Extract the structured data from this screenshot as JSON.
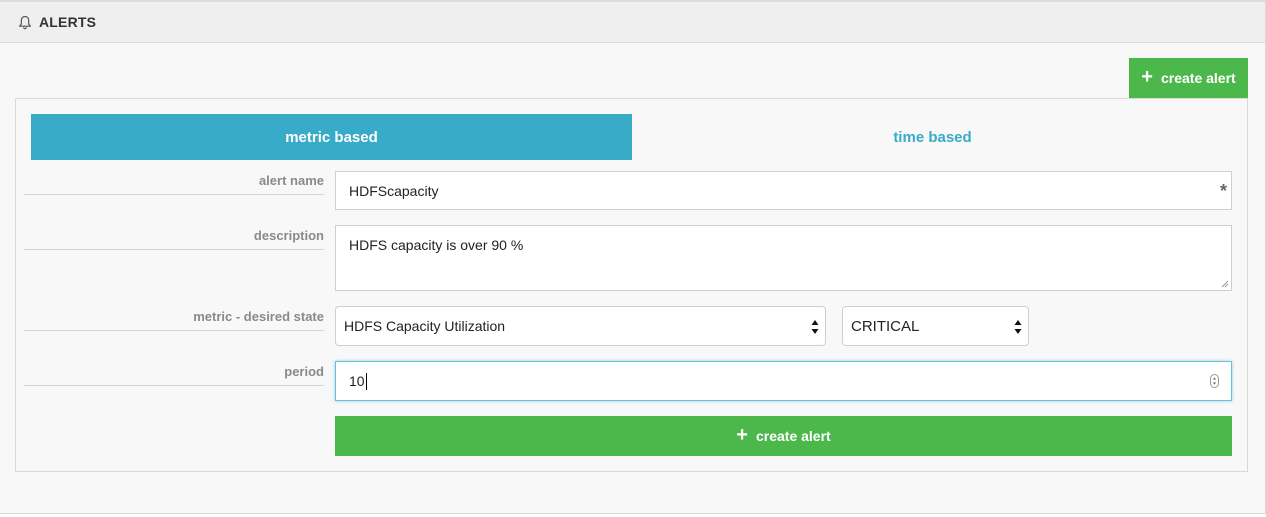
{
  "header": {
    "title": "ALERTS",
    "icon": "bell-icon"
  },
  "actions": {
    "create_alert_label": "create alert",
    "plus_glyph": "+"
  },
  "tabs": [
    {
      "label": "metric based",
      "active": true
    },
    {
      "label": "time based",
      "active": false
    }
  ],
  "form": {
    "alert_name": {
      "label": "alert name",
      "value": "HDFScapacity",
      "required_marker": "*"
    },
    "description": {
      "label": "description",
      "value": "HDFS capacity is over 90 %"
    },
    "metric": {
      "label": "metric - desired state",
      "selected_metric": "HDFS Capacity Utilization",
      "selected_state": "CRITICAL"
    },
    "period": {
      "label": "period",
      "value": "10"
    },
    "submit_label": "create alert"
  },
  "colors": {
    "accent": "#38abc8",
    "success": "#4cb84c",
    "header_bg": "#efefef"
  }
}
